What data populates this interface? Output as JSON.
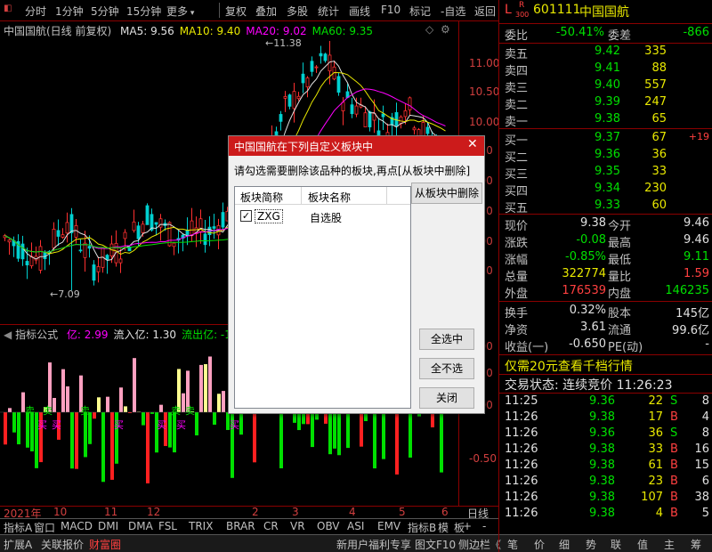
{
  "toolbar": {
    "left_items": [
      "分时",
      "1分钟",
      "5分钟",
      "15分钟",
      "更多"
    ],
    "right_items": [
      "复权",
      "叠加",
      "多股",
      "统计",
      "画线",
      "F10",
      "标记",
      "-自选",
      "返回"
    ]
  },
  "chart": {
    "title": "中国国航(日线 前复权)",
    "ma": [
      {
        "label": "MA5: 9.56",
        "color": "#e0e0e0"
      },
      {
        "label": "MA10: 9.40",
        "color": "#e8e800"
      },
      {
        "label": "MA20: 9.02",
        "color": "#ff00ff"
      },
      {
        "label": "MA60: 9.35",
        "color": "#00e000"
      }
    ],
    "high_mark": "11.38",
    "low_mark": "7.09",
    "yticks": [
      "11.00",
      "10.50",
      "10.00",
      "9.50",
      "9.00",
      "8.50",
      "8.00",
      "7.50"
    ]
  },
  "indicator": {
    "title": "指标公式",
    "items": [
      {
        "label": "亿: 2.99",
        "color": "#ff00ff"
      },
      {
        "label": "流入亿: 1.30",
        "color": "#e0e0e0"
      },
      {
        "label": "流出亿: -1.6",
        "color": "#00e000"
      }
    ],
    "yticks": [
      "1.00",
      "0.50",
      "0.00",
      "-0.50"
    ],
    "buy_labels": [
      "买",
      "买",
      "买",
      "买",
      "买",
      "买"
    ],
    "sell_labels": [
      "卖",
      "卖",
      "卖",
      "卖",
      "卖"
    ]
  },
  "xaxis": {
    "labels": [
      "2021年",
      "10",
      "11",
      "12",
      "2",
      "3",
      "4",
      "5",
      "6"
    ],
    "period": "日线"
  },
  "tabs": [
    "指标A",
    "窗口",
    "MACD",
    "DMI",
    "DMA",
    "FSL",
    "TRIX",
    "BRAR",
    "CR",
    "VR",
    "OBV",
    "ASI",
    "EMV",
    "指标B",
    "模",
    "板"
  ],
  "statusbar": [
    "扩展A",
    "关联报价",
    "财富圈",
    "新用户福利专享",
    "图文F10",
    "侧边栏《",
    "笔",
    "价",
    "细",
    "势",
    "联",
    "值",
    "主",
    "筹"
  ],
  "quote": {
    "header": {
      "prefix": "L",
      "sup": "R",
      "sub": "300",
      "code": "601111",
      "name": "中国国航"
    },
    "weibi": {
      "label": "委比",
      "value": "-50.41%",
      "label2": "委差",
      "value2": "-866"
    },
    "sells": [
      {
        "label": "卖五",
        "price": "9.42",
        "vol": "335"
      },
      {
        "label": "卖四",
        "price": "9.41",
        "vol": "88"
      },
      {
        "label": "卖三",
        "price": "9.40",
        "vol": "557"
      },
      {
        "label": "卖二",
        "price": "9.39",
        "vol": "247"
      },
      {
        "label": "卖一",
        "price": "9.38",
        "vol": "65"
      }
    ],
    "buys": [
      {
        "label": "买一",
        "price": "9.37",
        "vol": "67",
        "chg": "+19"
      },
      {
        "label": "买二",
        "price": "9.36",
        "vol": "36",
        "chg": ""
      },
      {
        "label": "买三",
        "price": "9.35",
        "vol": "33",
        "chg": ""
      },
      {
        "label": "买四",
        "price": "9.34",
        "vol": "230",
        "chg": ""
      },
      {
        "label": "买五",
        "price": "9.33",
        "vol": "60",
        "chg": ""
      }
    ],
    "stats": [
      {
        "l1": "现价",
        "v1": "9.38",
        "c1": "#e0e0e0",
        "l2": "今开",
        "v2": "9.46",
        "c2": "#e0e0e0"
      },
      {
        "l1": "涨跌",
        "v1": "-0.08",
        "c1": "#00e000",
        "l2": "最高",
        "v2": "9.46",
        "c2": "#e0e0e0"
      },
      {
        "l1": "涨幅",
        "v1": "-0.85%",
        "c1": "#00e000",
        "l2": "最低",
        "v2": "9.11",
        "c2": "#00e000"
      },
      {
        "l1": "总量",
        "v1": "322774",
        "c1": "#e8e800",
        "l2": "量比",
        "v2": "1.59",
        "c2": "#ff4040"
      },
      {
        "l1": "外盘",
        "v1": "176539",
        "c1": "#ff4040",
        "l2": "内盘",
        "v2": "146235",
        "c2": "#00e000"
      }
    ],
    "stats2": [
      {
        "l1": "换手",
        "v1": "0.32%",
        "l2": "股本",
        "v2": "145亿"
      },
      {
        "l1": "净资",
        "v1": "3.61",
        "l2": "流通",
        "v2": "99.6亿"
      },
      {
        "l1": "收益(一)",
        "v1": "-0.650",
        "l2": "PE(动)",
        "v2": "-"
      }
    ],
    "promo": "仅需20元查看千档行情",
    "status": "交易状态: 连续竞价 11:26:23",
    "ticks": [
      {
        "time": "11:25",
        "price": "9.36",
        "pc": "#00e000",
        "vol": "22",
        "bs": "S",
        "n": "8"
      },
      {
        "time": "11:26",
        "price": "9.38",
        "pc": "#00e000",
        "vol": "17",
        "bs": "B",
        "n": "4"
      },
      {
        "time": "11:26",
        "price": "9.36",
        "pc": "#00e000",
        "vol": "36",
        "bs": "S",
        "n": "8"
      },
      {
        "time": "11:26",
        "price": "9.38",
        "pc": "#00e000",
        "vol": "33",
        "bs": "B",
        "n": "16"
      },
      {
        "time": "11:26",
        "price": "9.38",
        "pc": "#00e000",
        "vol": "61",
        "bs": "B",
        "n": "15"
      },
      {
        "time": "11:26",
        "price": "9.38",
        "pc": "#00e000",
        "vol": "23",
        "bs": "B",
        "n": "6"
      },
      {
        "time": "11:26",
        "price": "9.38",
        "pc": "#00e000",
        "vol": "107",
        "bs": "B",
        "n": "38"
      },
      {
        "time": "11:26",
        "price": "9.38",
        "pc": "#00e000",
        "vol": "4",
        "bs": "B",
        "n": "5"
      }
    ]
  },
  "dialog": {
    "title": "中国国航在下列自定义板块中",
    "instruction": "请勾选需要删除该品种的板块,再点[从板块中删除]",
    "col1": "板块简称",
    "col2": "板块名称",
    "rows": [
      {
        "short": "ZXG",
        "name": "自选股",
        "checked": true
      }
    ],
    "btn_delete": "从板块中删除",
    "btn_all": "全选中",
    "btn_none": "全不选",
    "btn_close": "关闭"
  },
  "colors": {
    "up": "#ff4040",
    "down": "#00e000",
    "border": "#8b0000",
    "accent": "#cc1b1b"
  }
}
